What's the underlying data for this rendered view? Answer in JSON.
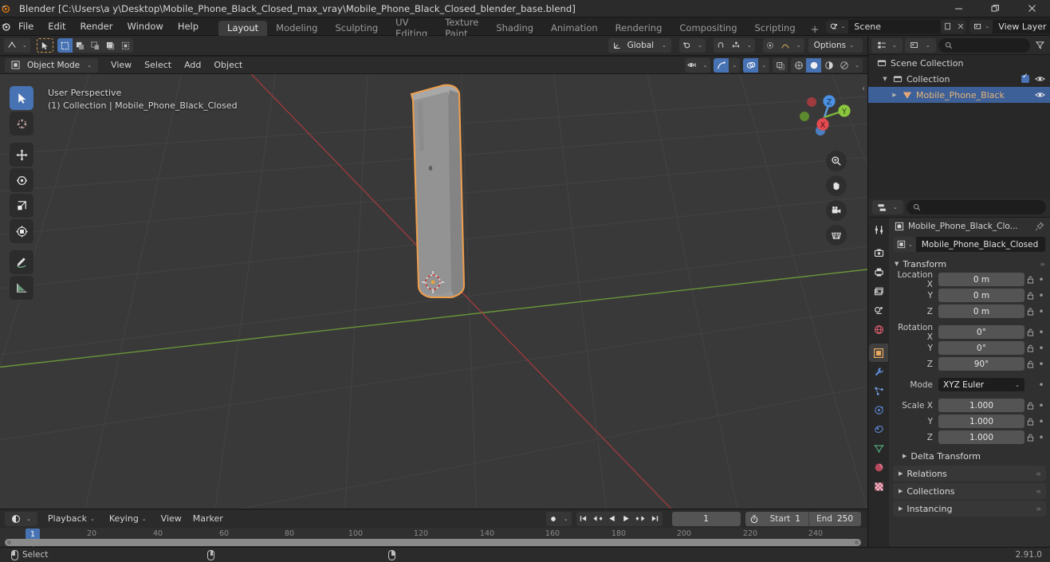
{
  "window": {
    "title": "Blender [C:\\Users\\a y\\Desktop\\Mobile_Phone_Black_Closed_max_vray\\Mobile_Phone_Black_Closed_blender_base.blend]",
    "minimize": "–",
    "restore": "❐",
    "close": "✕"
  },
  "menubar": {
    "items": [
      "File",
      "Edit",
      "Render",
      "Window",
      "Help"
    ],
    "tabs": [
      "Layout",
      "Modeling",
      "Sculpting",
      "UV Editing",
      "Texture Paint",
      "Shading",
      "Animation",
      "Rendering",
      "Compositing",
      "Scripting"
    ],
    "active_tab": "Layout",
    "add_tab": "+",
    "scene_name": "Scene",
    "view_layer_name": "View Layer"
  },
  "viewport_header": {
    "orientation": "Global",
    "options": "Options",
    "chevron": "⌄"
  },
  "viewport_subheader": {
    "mode": "Object Mode",
    "menus": [
      "View",
      "Select",
      "Add",
      "Object"
    ]
  },
  "viewport": {
    "perspective_label": "User Perspective",
    "object_label": "(1) Collection | Mobile_Phone_Black_Closed",
    "gizmo_axes": {
      "x": "X",
      "y": "Y",
      "z": "Z"
    },
    "colors": {
      "background": "#393939",
      "selection_outline": "#ed9e4f",
      "x_axis": "#a33b3f",
      "y_axis": "#6d9e3a",
      "object_fill": "#8e8e8e"
    }
  },
  "timeline": {
    "menus": [
      "Playback",
      "Keying",
      "View",
      "Marker"
    ],
    "current_frame": "1",
    "start_label": "Start",
    "start_value": "1",
    "end_label": "End",
    "end_value": "250",
    "ticks": [
      "20",
      "40",
      "60",
      "80",
      "100",
      "120",
      "140",
      "160",
      "180",
      "200",
      "220",
      "240"
    ],
    "playhead_frame": "1"
  },
  "statusbar": {
    "select_label": "Select",
    "version": "2.91.0"
  },
  "outliner": {
    "search_placeholder": "",
    "rows": [
      {
        "name": "Scene Collection",
        "icon": "collection-icon",
        "indent": 0,
        "selected": false,
        "has_tri": false,
        "has_check": false,
        "has_eye": false
      },
      {
        "name": "Collection",
        "icon": "collection-icon",
        "indent": 1,
        "selected": false,
        "has_tri": true,
        "has_check": true,
        "has_eye": true
      },
      {
        "name": "Mobile_Phone_Black",
        "icon": "mesh-icon",
        "indent": 2,
        "selected": true,
        "has_tri": true,
        "has_check": false,
        "has_eye": true
      }
    ]
  },
  "properties": {
    "search_placeholder": "",
    "breadcrumb": "Mobile_Phone_Black_Clo...",
    "object_name": "Mobile_Phone_Black_Closed",
    "panels": {
      "transform": "Transform",
      "delta_transform": "Delta Transform",
      "relations": "Relations",
      "collections": "Collections",
      "instancing": "Instancing"
    },
    "transform_rows": [
      {
        "label": "Location X",
        "value": "0 m"
      },
      {
        "label": "Y",
        "value": "0 m"
      },
      {
        "label": "Z",
        "value": "0 m"
      },
      {
        "label": "Rotation X",
        "value": "0°"
      },
      {
        "label": "Y",
        "value": "0°"
      },
      {
        "label": "Z",
        "value": "90°"
      },
      {
        "label": "Mode",
        "value": "XYZ Euler"
      },
      {
        "label": "Scale X",
        "value": "1.000"
      },
      {
        "label": "Y",
        "value": "1.000"
      },
      {
        "label": "Z",
        "value": "1.000"
      }
    ],
    "tabs": [
      "tool-icon",
      "render-icon",
      "output-icon",
      "view-layer-icon",
      "scene-icon",
      "world-icon",
      "object-icon",
      "modifier-icon",
      "particles-icon",
      "physics-icon",
      "constraints-icon",
      "data-icon",
      "material-icon",
      "texture-icon"
    ],
    "active_tab": "object-icon"
  }
}
